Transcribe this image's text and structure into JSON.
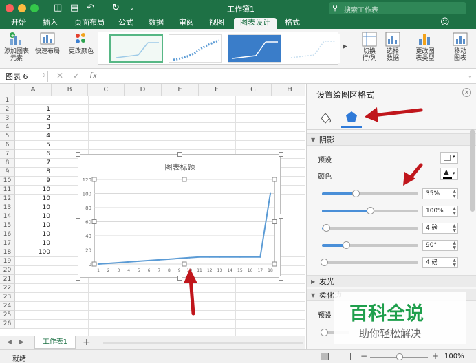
{
  "window": {
    "title": "工作簿1"
  },
  "search": {
    "placeholder": "搜索工作表"
  },
  "tabs": [
    "开始",
    "插入",
    "页面布局",
    "公式",
    "数据",
    "审阅",
    "视图",
    "图表设计",
    "格式"
  ],
  "ribbon": {
    "add_element": "添加图表\n元素",
    "quick_layout": "快速布局",
    "change_color": "更改颜色",
    "switch_rowcol": "切换\n行/列",
    "select_data": "选择\n数据",
    "change_type": "更改图\n表类型",
    "move_chart": "移动\n图表"
  },
  "formula": {
    "name_box": "图表 6",
    "fx": "fx"
  },
  "grid": {
    "columns": [
      "A",
      "B",
      "C",
      "D",
      "E",
      "F",
      "G",
      "H"
    ],
    "rows": [
      "1",
      "2",
      "3",
      "4",
      "5",
      "6",
      "7",
      "8",
      "9",
      "10",
      "11",
      "12",
      "13",
      "14",
      "15",
      "16",
      "17",
      "18",
      "19",
      "20",
      "21",
      "22",
      "23",
      "24",
      "25",
      "26"
    ],
    "col_a_values": [
      "",
      "1",
      "2",
      "3",
      "4",
      "5",
      "6",
      "7",
      "8",
      "9",
      "10",
      "10",
      "10",
      "10",
      "10",
      "10",
      "10",
      "100"
    ]
  },
  "chart": {
    "title": "图表标题"
  },
  "chart_data": {
    "type": "line",
    "title": "图表标题",
    "categories": [
      "1",
      "2",
      "3",
      "4",
      "5",
      "6",
      "7",
      "8",
      "9",
      "10",
      "11",
      "12",
      "13",
      "14",
      "15",
      "16",
      "17",
      "18"
    ],
    "series": [
      {
        "values": [
          0,
          1,
          2,
          3,
          4,
          5,
          6,
          7,
          8,
          9,
          10,
          10,
          10,
          10,
          10,
          10,
          10,
          100
        ]
      }
    ],
    "yticks": [
      "0",
      "20",
      "40",
      "60",
      "80",
      "100",
      "120"
    ],
    "ylim": [
      0,
      120
    ],
    "grid": true,
    "line_color": "#5b9bd5"
  },
  "sheet": {
    "tab": "工作表1",
    "add": "+"
  },
  "status": {
    "text": "就绪",
    "zoom": "100%"
  },
  "pane": {
    "title": "设置绘图区格式",
    "shadow": "阴影",
    "preset": "预设",
    "color": "颜色",
    "sliders": [
      {
        "value": "35%",
        "fraction": 0.35
      },
      {
        "value": "100%",
        "fraction": 0.5
      },
      {
        "value": "4 磅",
        "fraction": 0.04
      },
      {
        "value": "90°",
        "fraction": 0.25
      },
      {
        "value": "4 磅",
        "fraction": 0.02
      }
    ],
    "glow": "发光",
    "soft_edge": "柔化边",
    "preset2": "预设"
  },
  "watermark": {
    "title": "百科全说",
    "subtitle": "助你轻松解决"
  },
  "colors": {
    "accent": "#1e7145",
    "arrow": "#c0161c"
  }
}
